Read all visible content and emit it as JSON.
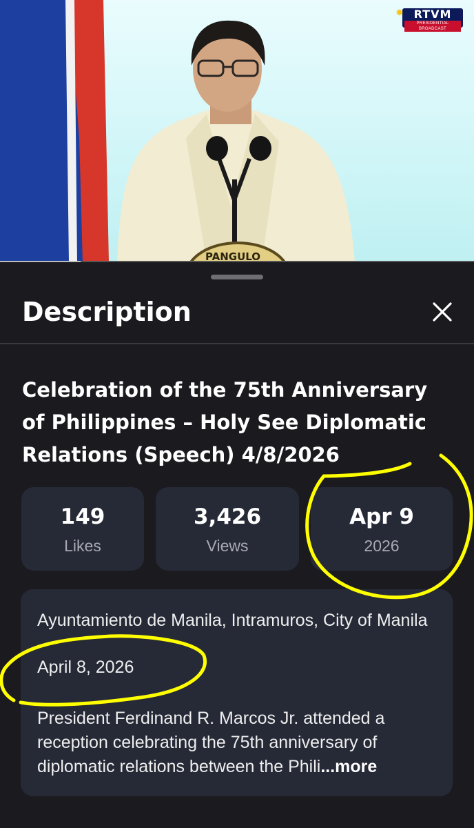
{
  "video": {
    "channel_logo": "RTVM",
    "channel_logo_sub": "PRESIDENTIAL BROADCAST",
    "podium_seal_text": "PANGULO",
    "progress_fraction": 0.17
  },
  "sheet": {
    "title": "Description",
    "close_icon": "close-icon"
  },
  "video_title": "Celebration of the 75th Anniversary of Philippines – Holy See Diplomatic Relations (Speech) 4/8/2026",
  "stats": [
    {
      "value": "149",
      "label": "Likes"
    },
    {
      "value": "3,426",
      "label": "Views"
    },
    {
      "value": "Apr 9",
      "label": "2026"
    }
  ],
  "details": {
    "location": "Ayuntamiento de Manila, Intramuros, City of Manila",
    "date": "April 8, 2026",
    "description": "President Ferdinand R. Marcos Jr. attended a reception celebrating the 75th anniversary of diplomatic relations between the Phili",
    "more_label": "...more"
  },
  "colors": {
    "sheet_bg": "#1b1a1f",
    "card_bg": "#262a37",
    "highlight": "#ffff00"
  }
}
